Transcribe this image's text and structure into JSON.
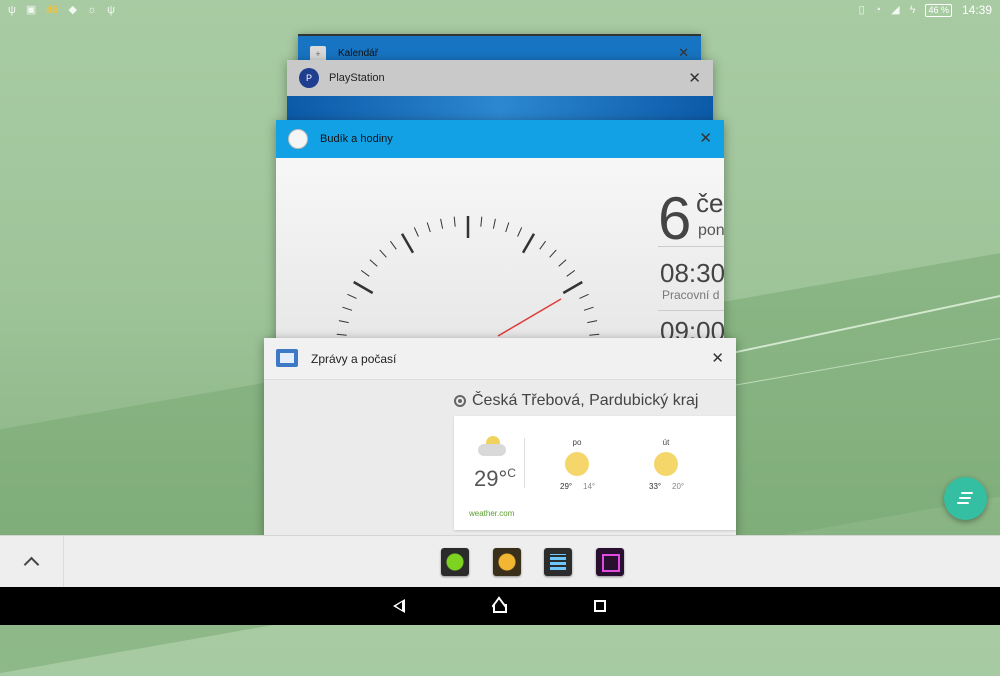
{
  "status_bar": {
    "left_icons": [
      "usb-icon",
      "image-icon",
      "46",
      "arrows-icon",
      "bulb-icon",
      "usb-settings-icon"
    ],
    "signal_label": "46",
    "battery": "46 %",
    "time": "14:39"
  },
  "recent_apps": [
    {
      "title": "Kalendář"
    },
    {
      "title": "PlayStation"
    },
    {
      "title": "Budík a hodiny"
    },
    {
      "title": "Zprávy a počasí"
    }
  ],
  "clock_widget": {
    "day": "6",
    "month": "če",
    "weekday": "pon",
    "alarm1_time": "08:30",
    "alarm1_label": "Pracovní d",
    "alarm2_time": "09:00"
  },
  "news_weather": {
    "location": "Česká Třebová, Pardubický kraj",
    "current_temp": "29°",
    "unit": "C",
    "forecast": [
      {
        "day": "po",
        "high": "29°",
        "low": "14°"
      },
      {
        "day": "út",
        "high": "33°",
        "low": "20°"
      }
    ],
    "source": "weather.com"
  },
  "close_symbol": "✕",
  "dock_apps": [
    "maps-app-icon",
    "lifelog-app-icon",
    "calculator-app-icon",
    "photo-editor-app-icon"
  ]
}
